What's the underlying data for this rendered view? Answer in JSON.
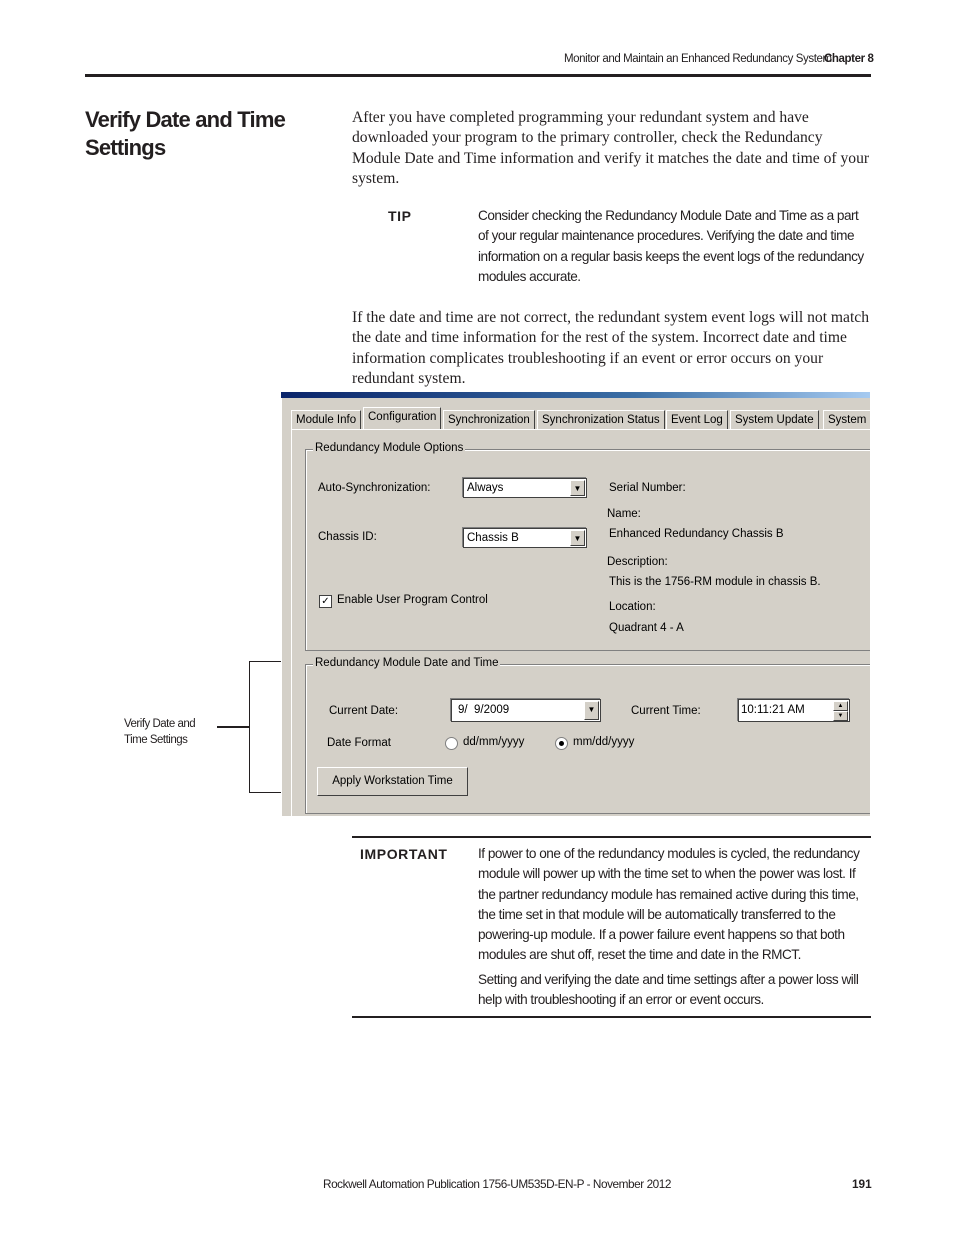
{
  "header": {
    "section": "Monitor and Maintain an Enhanced Redundancy System",
    "chapter": "Chapter 8"
  },
  "title": "Verify Date and Time Settings",
  "paragraphs": [
    "After you have completed programming your redundant system and have downloaded your program to the primary controller, check the Redundancy Module Date and Time information and verify it matches the date and time of your system.",
    "If the date and time are not correct, the redundant system event logs will not match the date and time information for the rest of the system. Incorrect date and time information complicates troubleshooting if an event or error occurs on your redundant system."
  ],
  "tip": {
    "label": "TIP",
    "text": "Consider checking the Redundancy Module Date and Time as a part of your regular maintenance procedures. Verifying the date and time information on a regular basis keeps the event logs of the redundancy modules accurate."
  },
  "callout": "Verify Date and Time Settings",
  "dialog": {
    "tabs": [
      "Module Info",
      "Configuration",
      "Synchronization",
      "Synchronization Status",
      "Event Log",
      "System Update",
      "System"
    ],
    "active_tab": "Configuration",
    "options_group": "Redundancy Module Options",
    "auto_sync_label": "Auto-Synchronization:",
    "auto_sync_value": "Always",
    "chassis_label": "Chassis ID:",
    "chassis_value": "Chassis B",
    "enable_upc": "Enable User Program Control",
    "enable_upc_checked": true,
    "serial_label": "Serial Number:",
    "name_label": "Name:",
    "name_value": "Enhanced Redundancy Chassis B",
    "desc_label": "Description:",
    "desc_value": "This is the 1756-RM module in chassis B.",
    "loc_label": "Location:",
    "loc_value": "Quadrant 4 - A",
    "dt_group": "Redundancy Module Date and Time",
    "date_label": "Current Date:",
    "date_value": "9/  9/2009",
    "time_label": "Current Time:",
    "time_value": "10:11:21 AM",
    "format_label": "Date Format",
    "format_options": [
      "dd/mm/yyyy",
      "mm/dd/yyyy"
    ],
    "format_selected": "mm/dd/yyyy",
    "apply_button": "Apply Workstation Time"
  },
  "important": {
    "label": "IMPORTANT",
    "texts": [
      "If power to one of the redundancy modules is cycled, the redundancy module will power up with the time set to when the power was lost. If the partner redundancy module has remained active during this time, the time set in that module will be automatically transferred to the powering-up module. If a power failure event happens so that both modules are shut off, reset the time and date in the RMCT.",
      "Setting and verifying the date and time settings after a power loss will help with troubleshooting if an error or event occurs."
    ]
  },
  "footer": {
    "publication": "Rockwell Automation Publication 1756-UM535D-EN-P - November 2012",
    "page": "191"
  }
}
